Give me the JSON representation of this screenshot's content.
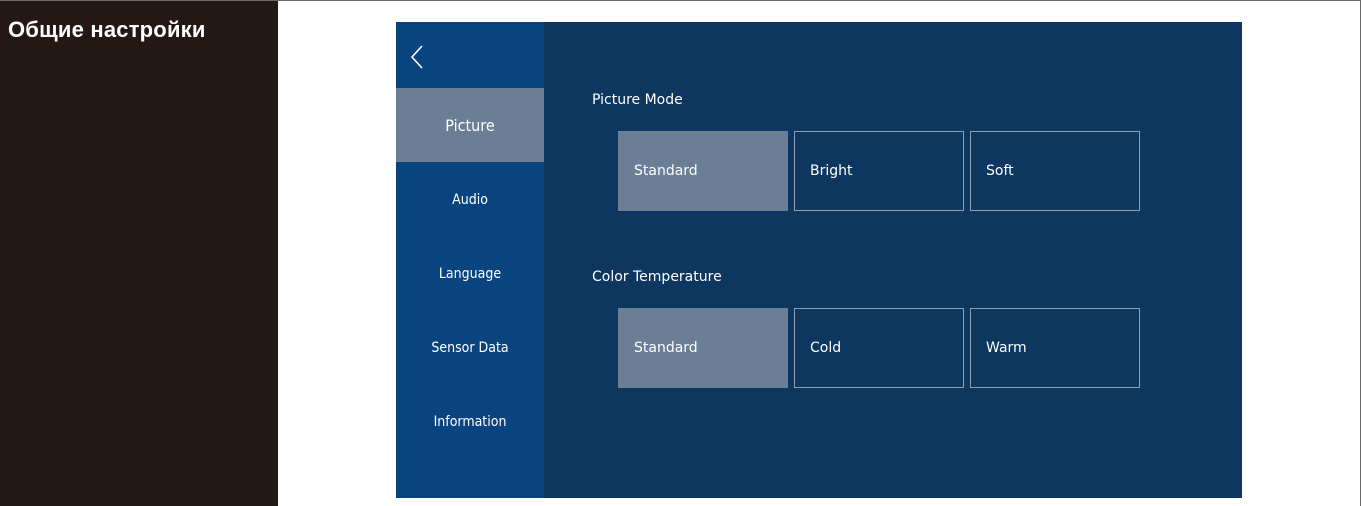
{
  "left_title": "Общие настройки",
  "sidebar": {
    "back_icon": "chevron-left-icon",
    "items": [
      {
        "label": "Picture",
        "active": true
      },
      {
        "label": "Audio",
        "active": false
      },
      {
        "label": "Language",
        "active": false
      },
      {
        "label": "Sensor Data",
        "active": false
      },
      {
        "label": "Information",
        "active": false
      }
    ]
  },
  "picture_mode": {
    "label": "Picture Mode",
    "options": [
      "Standard",
      "Bright",
      "Soft"
    ],
    "selected": "Standard"
  },
  "color_temperature": {
    "label": "Color Temperature",
    "options": [
      "Standard",
      "Cold",
      "Warm"
    ],
    "selected": "Standard"
  },
  "colors": {
    "left_panel": "#231815",
    "screen_bg": "#0e3760",
    "sidebar_bg": "#0a4480",
    "highlight": "#6a7f96"
  }
}
